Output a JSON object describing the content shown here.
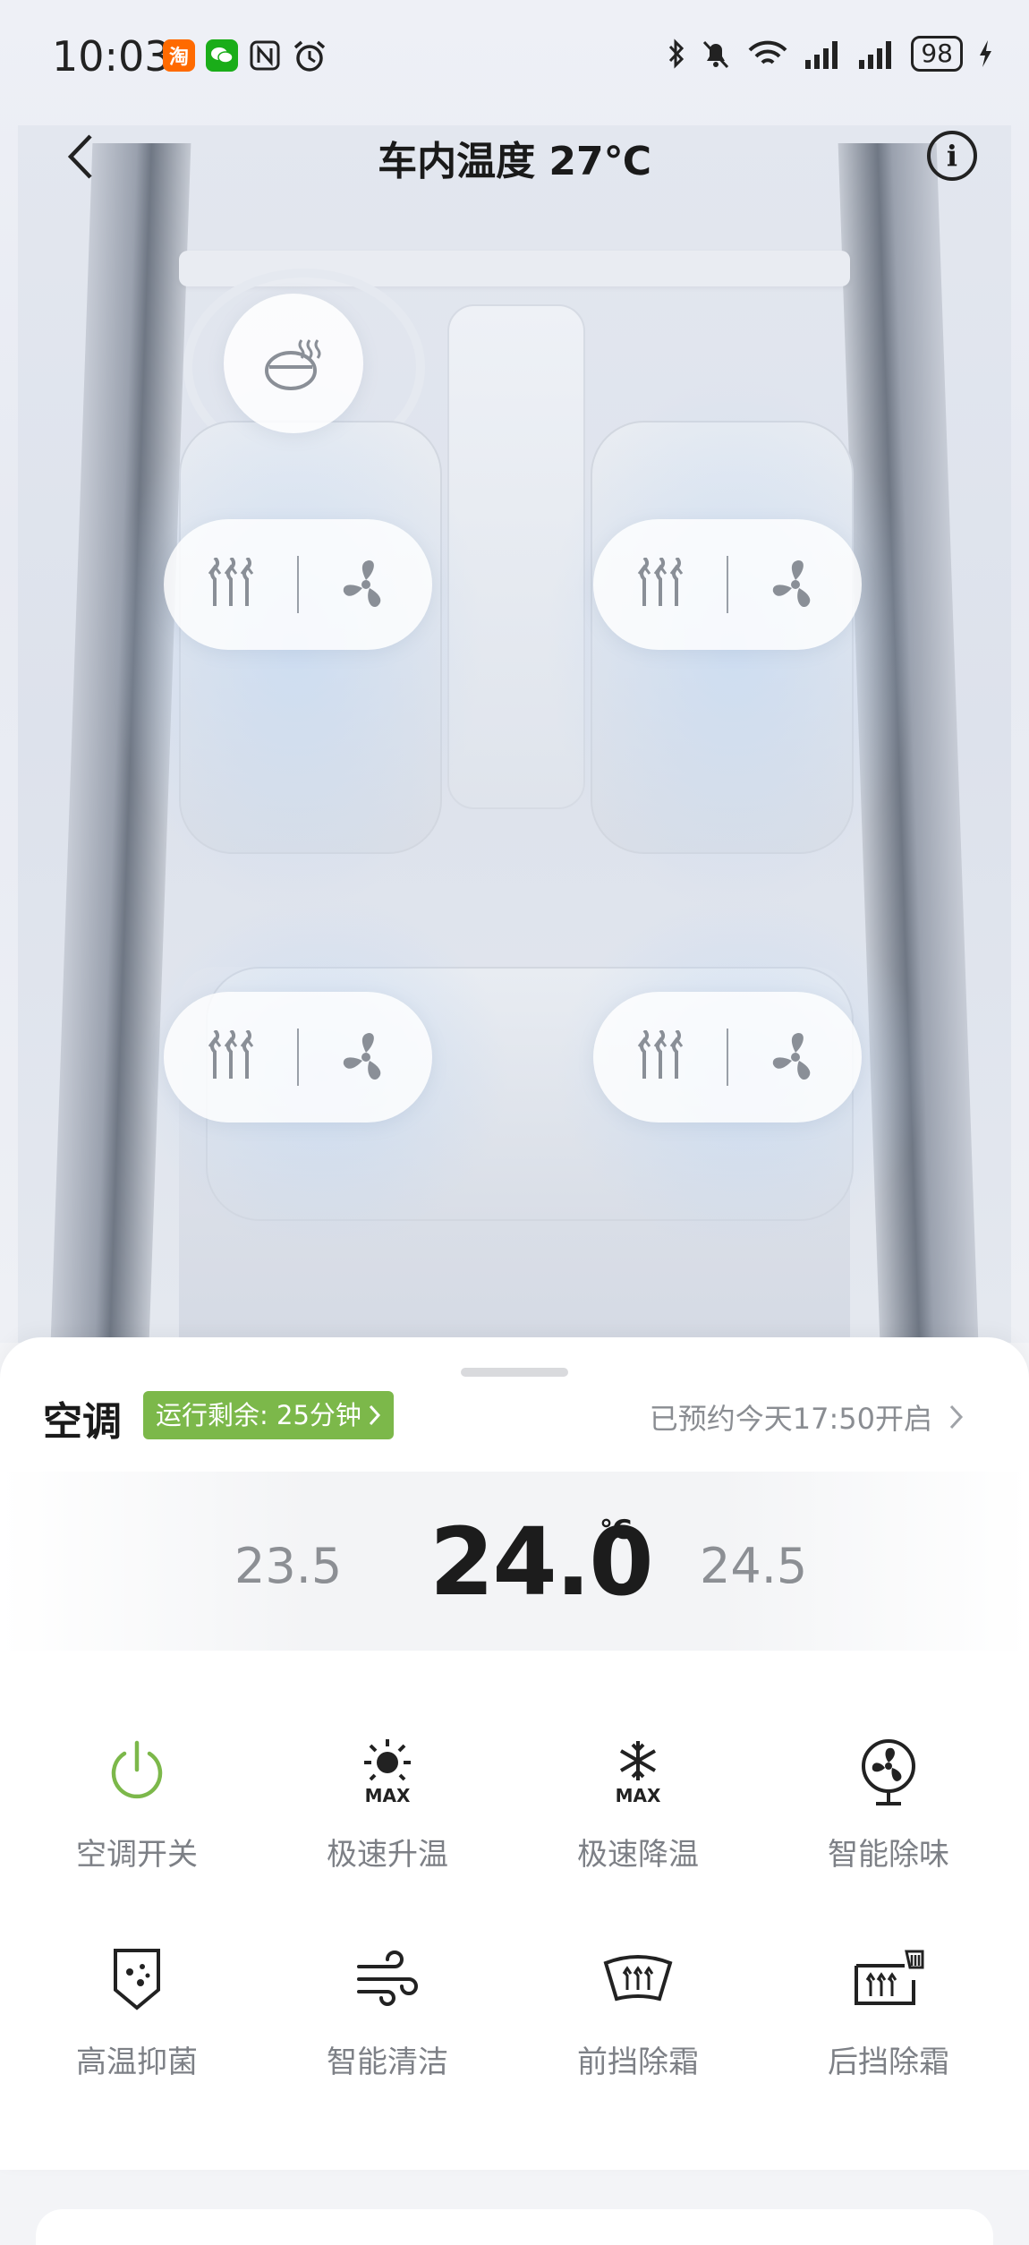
{
  "status_bar": {
    "time": "10:03",
    "battery": "98",
    "apps": [
      {
        "name": "taobao",
        "glyph": "淘",
        "color": "#ff6a00"
      },
      {
        "name": "wechat",
        "glyph": "✉",
        "color": "#1aad19"
      }
    ]
  },
  "header": {
    "title": "车内温度 27℃"
  },
  "ac": {
    "title": "空调",
    "remaining": "运行剩余: 25分钟",
    "schedule": "已预约今天17:50开启",
    "temp_lower": "23.5",
    "temp_current": "24.0",
    "temp_unit": "℃",
    "temp_higher": "24.5",
    "accent": "#7cb84a"
  },
  "functions": [
    {
      "label": "空调开关",
      "icon": "power-icon"
    },
    {
      "label": "极速升温",
      "icon": "sun-max-icon"
    },
    {
      "label": "极速降温",
      "icon": "snowflake-max-icon"
    },
    {
      "label": "智能除味",
      "icon": "fan-icon"
    },
    {
      "label": "高温抑菌",
      "icon": "shield-icon"
    },
    {
      "label": "智能清洁",
      "icon": "wind-icon"
    },
    {
      "label": "前挡除霜",
      "icon": "front-defrost-icon"
    },
    {
      "label": "后挡除霜",
      "icon": "rear-defrost-icon"
    }
  ],
  "icon_labels": {
    "max": "MAX"
  }
}
